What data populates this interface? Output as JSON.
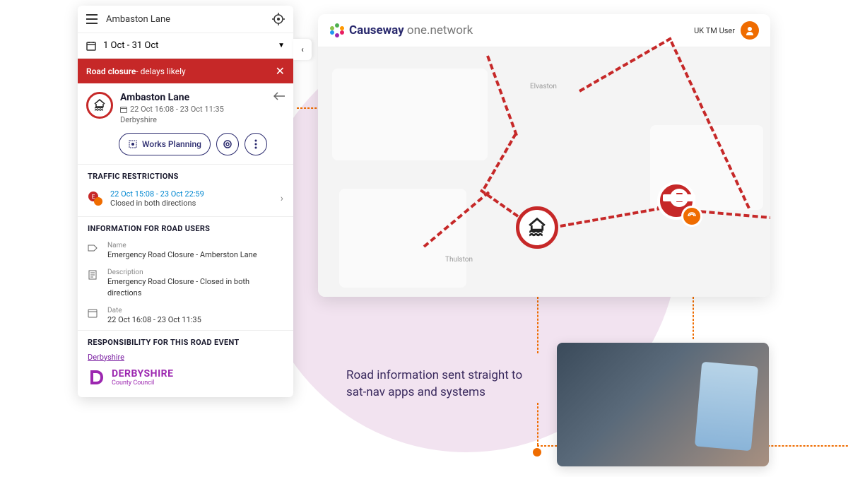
{
  "sidebar": {
    "search_text": "Ambaston Lane",
    "date_range": "1 Oct - 31 Oct",
    "alert": {
      "bold": "Road closure",
      "rest": " - delays likely"
    },
    "detail": {
      "title": "Ambaston Lane",
      "time": "22 Oct 16:08 - 23 Oct 11:35",
      "location": "Derbyshire"
    },
    "works_btn": "Works Planning",
    "sections": {
      "restrictions_title": "TRAFFIC RESTRICTIONS",
      "restriction": {
        "time": "22 Oct 15:08 - 23 Oct 22:59",
        "desc": "Closed in both directions"
      },
      "info_title": "INFORMATION FOR ROAD USERS",
      "info_name_label": "Name",
      "info_name_value": "Emergency Road Closure - Amberston Lane",
      "info_desc_label": "Description",
      "info_desc_value": "Emergency Road Closure - Closed in both directions",
      "info_date_label": "Date",
      "info_date_value": "22 Oct 16:08 - 23 Oct 11:35",
      "resp_title": "RESPONSIBILITY FOR THIS ROAD EVENT",
      "resp_link": "Derbyshire",
      "dcc_big": "DERBYSHIRE",
      "dcc_small": "County Council"
    }
  },
  "map": {
    "brand": {
      "bold": "Causeway",
      "prod": " one.",
      "suffix": "network"
    },
    "user": "UK TM User",
    "label_elvaston": "Elvaston",
    "label_thulston": "Thulston",
    "e_badge": "E"
  },
  "caption": "Road information sent straight to sat-nav apps and systems"
}
